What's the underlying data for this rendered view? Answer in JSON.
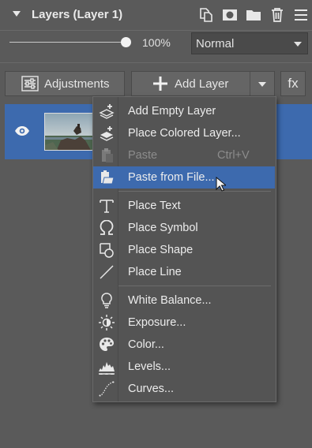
{
  "panel": {
    "title": "Layers (Layer 1)"
  },
  "header_icons": [
    "duplicate-icon",
    "mask-icon",
    "folder-icon",
    "trash-icon",
    "hamburger-menu-icon"
  ],
  "opacity": {
    "value": 100,
    "label": "100%"
  },
  "blend_mode": {
    "selected": "Normal"
  },
  "toolbar": {
    "adjustments_label": "Adjustments",
    "add_layer_label": "Add Layer",
    "fx_label": "fx"
  },
  "layer": {
    "visible": true,
    "selected": true,
    "thumbnail": "landscape-photo"
  },
  "menu": {
    "items": [
      {
        "label": "Add Empty Layer",
        "icon": "layer-stack-plus-icon",
        "disabled": false
      },
      {
        "label": "Place Colored Layer...",
        "icon": "layer-stack-filled-plus-icon",
        "disabled": false
      },
      {
        "label": "Paste",
        "icon": "paste-icon",
        "shortcut": "Ctrl+V",
        "disabled": true
      },
      {
        "label": "Paste from File...",
        "icon": "paste-from-file-icon",
        "disabled": false,
        "hover": true
      },
      {
        "label": "Place Text",
        "icon": "text-icon",
        "disabled": false
      },
      {
        "label": "Place Symbol",
        "icon": "omega-symbol-icon",
        "disabled": false
      },
      {
        "label": "Place Shape",
        "icon": "shape-icon",
        "disabled": false
      },
      {
        "label": "Place Line",
        "icon": "line-icon",
        "disabled": false
      },
      {
        "label": "White Balance...",
        "icon": "lightbulb-icon",
        "disabled": false
      },
      {
        "label": "Exposure...",
        "icon": "sun-icon",
        "disabled": false
      },
      {
        "label": "Color...",
        "icon": "palette-icon",
        "disabled": false
      },
      {
        "label": "Levels...",
        "icon": "histogram-icon",
        "disabled": false
      },
      {
        "label": "Curves...",
        "icon": "curve-icon",
        "disabled": false
      }
    ]
  },
  "colors": {
    "background": "#5a5a5a",
    "selection": "#3d6aae",
    "menu_background": "#545454"
  }
}
